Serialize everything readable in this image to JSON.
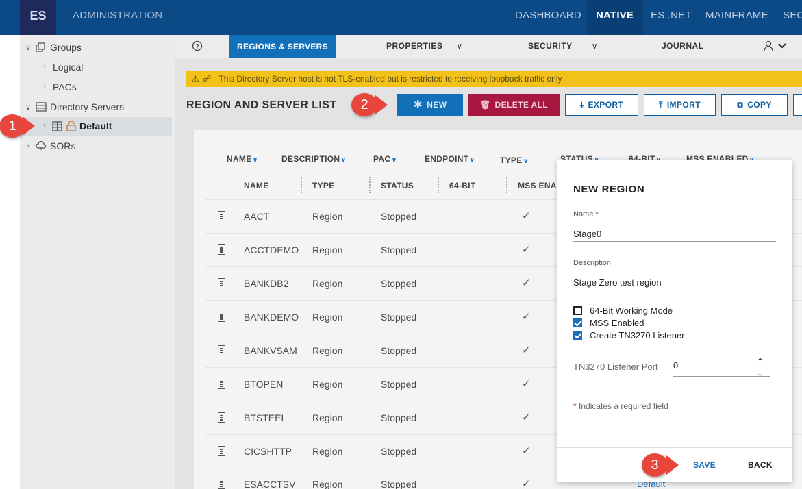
{
  "header": {
    "logo": "ES",
    "app_title": "ADMINISTRATION",
    "nav": [
      "DASHBOARD",
      "NATIVE",
      "ES .NET",
      "MAINFRAME",
      "SEC"
    ],
    "active_nav": "NATIVE"
  },
  "sidebar": {
    "groups": "Groups",
    "logical": "Logical",
    "pacs": "PACs",
    "directory_servers": "Directory Servers",
    "default": "Default",
    "sors": "SORs"
  },
  "badges": {
    "one": "1",
    "two": "2",
    "three": "3"
  },
  "tabs": {
    "regions_servers": "REGIONS & SERVERS",
    "properties": "PROPERTIES",
    "security": "SECURITY",
    "journal": "JOURNAL"
  },
  "warning": "This Directory Server host is not TLS-enabled but is restricted to receiving loopback traffic only",
  "section_title": "REGION AND SERVER LIST",
  "toolbar": {
    "new": "NEW",
    "delete_all": "DELETE ALL",
    "export": "EXPORT",
    "import": "IMPORT",
    "copy": "COPY"
  },
  "filters": [
    "NAME",
    "DESCRIPTION",
    "PAC",
    "ENDPOINT",
    "TYPE",
    "STATUS",
    "64-BIT",
    "MSS ENABLED"
  ],
  "columns": [
    "NAME",
    "TYPE",
    "STATUS",
    "64-BIT",
    "MSS ENA"
  ],
  "rows": [
    {
      "name": "AACT",
      "type": "Region",
      "status": "Stopped"
    },
    {
      "name": "ACCTDEMO",
      "type": "Region",
      "status": "Stopped"
    },
    {
      "name": "BANKDB2",
      "type": "Region",
      "status": "Stopped"
    },
    {
      "name": "BANKDEMO",
      "type": "Region",
      "status": "Stopped"
    },
    {
      "name": "BANKVSAM",
      "type": "Region",
      "status": "Stopped"
    },
    {
      "name": "BTOPEN",
      "type": "Region",
      "status": "Stopped"
    },
    {
      "name": "BTSTEEL",
      "type": "Region",
      "status": "Stopped"
    },
    {
      "name": "CICSHTTP",
      "type": "Region",
      "status": "Stopped"
    },
    {
      "name": "ESACCTSV",
      "type": "Region",
      "status": "Stopped"
    }
  ],
  "dialog": {
    "title": "NEW REGION",
    "name_label": "Name *",
    "name_value": "Stage0",
    "description_label": "Description",
    "description_value": "Stage Zero test region",
    "checkboxes": [
      {
        "label": "64-Bit Working Mode",
        "checked": false
      },
      {
        "label": "MSS Enabled",
        "checked": true
      },
      {
        "label": "Create TN3270 Listener",
        "checked": true
      }
    ],
    "port_label": "TN3270 Listener Port",
    "port_value": "0",
    "required_note": "Indicates a required field",
    "save": "SAVE",
    "back": "BACK"
  },
  "default_link": "Default",
  "colors": {
    "header": "#0c4a87",
    "primary": "#1170b8",
    "danger": "#a8173f",
    "warning": "#f2c21a",
    "badge": "#e8453c"
  }
}
